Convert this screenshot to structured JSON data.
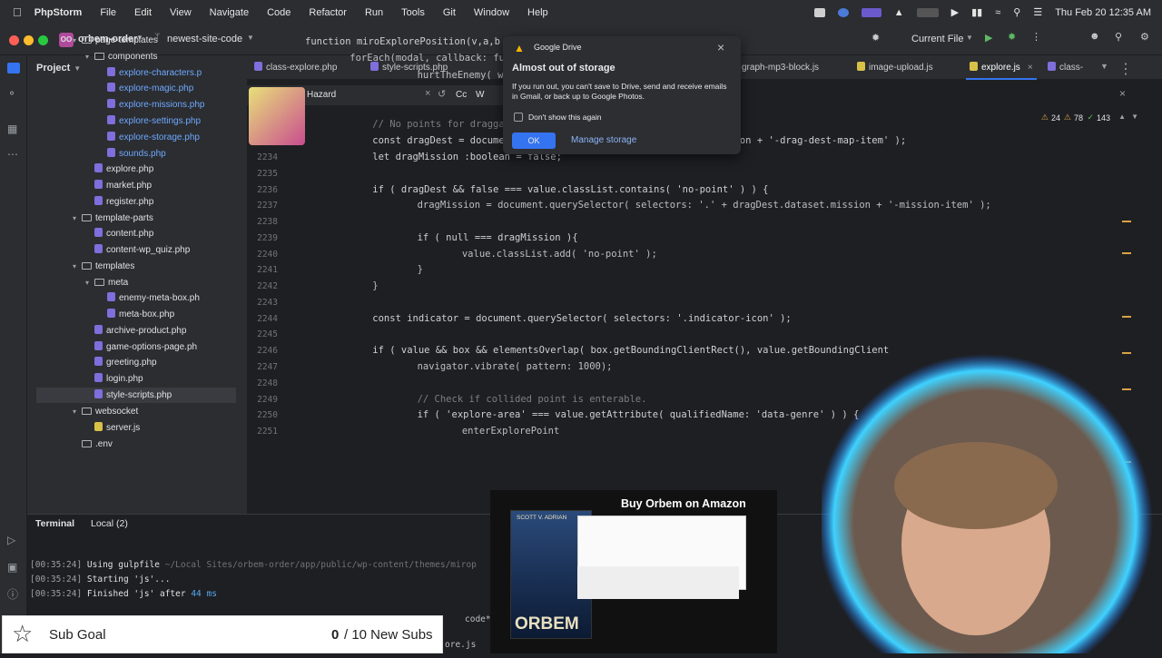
{
  "menubar": {
    "app": "PhpStorm",
    "items": [
      "File",
      "Edit",
      "View",
      "Navigate",
      "Code",
      "Refactor",
      "Run",
      "Tools",
      "Git",
      "Window",
      "Help"
    ],
    "clock": "Thu Feb 20  12:35 AM"
  },
  "toolbar": {
    "project_badge": "OO",
    "project_name": "orbem-order",
    "branch": "newest-site-code",
    "run_config": "Current File"
  },
  "project_panel": {
    "title": "Project",
    "rows": [
      {
        "label": "page-templates",
        "type": "folder",
        "open": true
      },
      {
        "label": "components",
        "type": "folder",
        "open": true
      },
      {
        "label": "explore-characters.p",
        "type": "php"
      },
      {
        "label": "explore-magic.php",
        "type": "php"
      },
      {
        "label": "explore-missions.php",
        "type": "php"
      },
      {
        "label": "explore-settings.php",
        "type": "php"
      },
      {
        "label": "explore-storage.php",
        "type": "php"
      },
      {
        "label": "sounds.php",
        "type": "php"
      },
      {
        "label": "explore.php",
        "type": "php"
      },
      {
        "label": "market.php",
        "type": "php"
      },
      {
        "label": "register.php",
        "type": "php"
      },
      {
        "label": "template-parts",
        "type": "folder",
        "open": true
      },
      {
        "label": "content.php",
        "type": "php"
      },
      {
        "label": "content-wp_quiz.php",
        "type": "php"
      },
      {
        "label": "templates",
        "type": "folder",
        "open": true
      },
      {
        "label": "meta",
        "type": "folder",
        "open": true
      },
      {
        "label": "enemy-meta-box.ph",
        "type": "php"
      },
      {
        "label": "meta-box.php",
        "type": "php"
      },
      {
        "label": "archive-product.php",
        "type": "php"
      },
      {
        "label": "game-options-page.ph",
        "type": "php"
      },
      {
        "label": "greeting.php",
        "type": "php"
      },
      {
        "label": "login.php",
        "type": "php"
      },
      {
        "label": "style-scripts.php",
        "type": "php"
      },
      {
        "label": "websocket",
        "type": "folder",
        "open": true
      },
      {
        "label": "server.js",
        "type": "js"
      },
      {
        "label": ".env",
        "type": "file"
      }
    ]
  },
  "tabs": [
    "class-explore.php",
    "style-scripts.php",
    "graph-mp3-block.js",
    "image-upload.js",
    "explore.js",
    "class-"
  ],
  "findbar": {
    "query": "Hazard",
    "opt1": "Cc",
    "opt2": "W"
  },
  "inspections": {
    "warnings": "24",
    "weak": "78",
    "typos": "143"
  },
  "editor": {
    "lines": [
      {
        "n": "",
        "t": "function miroExplorePosition(v,a,b"
      },
      {
        "n": "",
        "t": "    forEach(modal, callback: function"
      },
      {
        "n": "",
        "t": "        hurtTheEnemy( weaponEl,"
      },
      {
        "n": "2230",
        "t": "    }"
      },
      {
        "n": "2231",
        "t": ""
      },
      {
        "n": "2232",
        "t": "    // No points for draggables."
      },
      {
        "n": "2233",
        "t": "    const dragDest = document.querySelector( selectors: '.' + position + '-drag-dest-map-item' );"
      },
      {
        "n": "2234",
        "t": "    let dragMission :boolean = false;"
      },
      {
        "n": "2235",
        "t": ""
      },
      {
        "n": "2236",
        "t": "    if ( dragDest && false === value.classList.contains( 'no-point' ) ) {"
      },
      {
        "n": "2237",
        "t": "        dragMission = document.querySelector( selectors: '.' + dragDest.dataset.mission + '-mission-item' );"
      },
      {
        "n": "2238",
        "t": ""
      },
      {
        "n": "2239",
        "t": "        if ( null === dragMission ){"
      },
      {
        "n": "2240",
        "t": "            value.classList.add( 'no-point' );"
      },
      {
        "n": "2241",
        "t": "        }"
      },
      {
        "n": "2242",
        "t": "    }"
      },
      {
        "n": "2243",
        "t": ""
      },
      {
        "n": "2244",
        "t": "    const indicator = document.querySelector( selectors: '.indicator-icon' );"
      },
      {
        "n": "2245",
        "t": ""
      },
      {
        "n": "2246",
        "t": "    if ( value && box && elementsOverlap( box.getBoundingClientRect(), value.getBoundingClient"
      },
      {
        "n": "2247",
        "t": "        navigator.vibrate( pattern: 1000);"
      },
      {
        "n": "2248",
        "t": ""
      },
      {
        "n": "2249",
        "t": "        // Check if collided point is enterable."
      },
      {
        "n": "2250",
        "t": "        if ( 'explore-area' === value.getAttribute( qualifiedName: 'data-genre' ) ) {"
      },
      {
        "n": "2251",
        "t": "            enterExplorePoint"
      }
    ]
  },
  "terminal": {
    "tab_terminal": "Terminal",
    "tab_local": "Local (2)",
    "lines": [
      {
        "time": "[00:35:24]",
        "text": " Using gulpfile ",
        "path": "~/Local Sites/orbem-order/app/public/wp-content/themes/mirop"
      },
      {
        "time": "[00:35:24]",
        "text": " Starting 'js'...",
        "path": ""
      },
      {
        "time": "[00:35:24]",
        "text": " Finished 'js' after ",
        "path": "44 ms"
      }
    ],
    "fragment1": "code* 6s",
    "fragment2": "ore.js"
  },
  "gdrive": {
    "app": "Google Drive",
    "title": "Almost out of storage",
    "body": "If you run out, you can't save to Drive, send and receive emails in Gmail, or back up to Google Photos.",
    "checkbox": "Don't show this again",
    "ok": "OK",
    "manage": "Manage storage"
  },
  "subgoal": {
    "label": "Sub Goal",
    "count": "0",
    "rest": "/ 10 New Subs"
  },
  "amazon": {
    "title": "Buy Orbem on Amazon",
    "author": "SCOTT V. ADRIAN",
    "book": "ORBEM"
  },
  "colors": {
    "accent": "#3574f0",
    "bg": "#1e1f22",
    "panel": "#2b2d30"
  }
}
